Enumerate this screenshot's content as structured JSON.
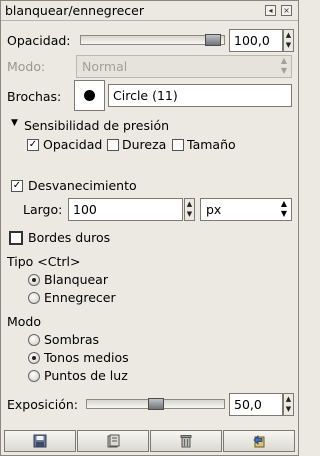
{
  "window": {
    "title": "blanquear/ennegrecer",
    "buttons": [
      "menu",
      "close"
    ]
  },
  "opacity": {
    "label": "Opacidad:",
    "value": "100,0",
    "fraction": 0.98
  },
  "mode": {
    "label": "Modo:",
    "value": "Normal",
    "disabled": true
  },
  "brush": {
    "label": "Brochas:",
    "value": "Circle (11)"
  },
  "pressure": {
    "expander_label": "Sensibilidad de presión",
    "options": [
      {
        "label": "Opacidad",
        "checked": true
      },
      {
        "label": "Dureza",
        "checked": false
      },
      {
        "label": "Tamaño",
        "checked": false
      }
    ]
  },
  "fade": {
    "label": "Desvanecimiento",
    "checked": true,
    "length_label": "Largo:",
    "length_value": "100",
    "unit": "px"
  },
  "hard_edges": {
    "label": "Bordes duros",
    "checked": false
  },
  "type": {
    "label": "Tipo  <Ctrl>",
    "options": [
      {
        "label": "Blanquear",
        "selected": true
      },
      {
        "label": "Ennegrecer",
        "selected": false
      }
    ]
  },
  "range_mode": {
    "label": "Modo",
    "options": [
      {
        "label": "Sombras",
        "selected": false
      },
      {
        "label": "Tonos medios",
        "selected": true
      },
      {
        "label": "Puntos de luz",
        "selected": false
      }
    ]
  },
  "exposure": {
    "label": "Exposición:",
    "value": "50,0",
    "fraction": 0.5
  },
  "bottom_buttons": [
    "save-icon",
    "restore-icon",
    "delete-icon",
    "reset-icon"
  ]
}
